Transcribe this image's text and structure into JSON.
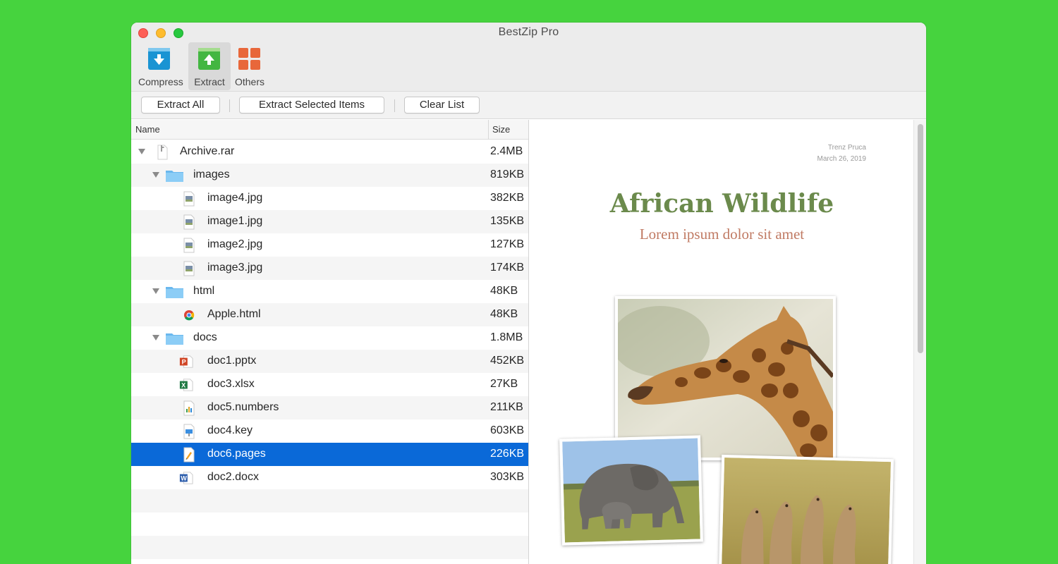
{
  "window": {
    "title": "BestZip Pro"
  },
  "toolbar": {
    "tools": [
      {
        "label": "Compress",
        "icon": "compress-icon",
        "color": "#1a94d3"
      },
      {
        "label": "Extract",
        "icon": "extract-icon",
        "color": "#43b641",
        "active": true
      },
      {
        "label": "Others",
        "icon": "grid-icon",
        "color": "#e8673a"
      }
    ]
  },
  "actions": {
    "extract_all": "Extract All",
    "extract_selected": "Extract Selected Items",
    "clear_list": "Clear List"
  },
  "filelist": {
    "columns": {
      "name": "Name",
      "size": "Size"
    },
    "rows": [
      {
        "name": "Archive.rar",
        "size": "2.4MB",
        "icon": "archive-icon",
        "expanded": true
      },
      {
        "name": "images",
        "size": "819KB",
        "icon": "folder-icon",
        "expanded": true
      },
      {
        "name": "image4.jpg",
        "size": "382KB",
        "icon": "image-file-icon"
      },
      {
        "name": "image1.jpg",
        "size": "135KB",
        "icon": "image-file-icon"
      },
      {
        "name": "image2.jpg",
        "size": "127KB",
        "icon": "image-file-icon"
      },
      {
        "name": "image3.jpg",
        "size": "174KB",
        "icon": "image-file-icon"
      },
      {
        "name": "html",
        "size": "48KB",
        "icon": "folder-icon",
        "expanded": true
      },
      {
        "name": "Apple.html",
        "size": "48KB",
        "icon": "chrome-html-icon"
      },
      {
        "name": "docs",
        "size": "1.8MB",
        "icon": "folder-icon",
        "expanded": true
      },
      {
        "name": "doc1.pptx",
        "size": "452KB",
        "icon": "powerpoint-icon"
      },
      {
        "name": "doc3.xlsx",
        "size": "27KB",
        "icon": "excel-icon"
      },
      {
        "name": "doc5.numbers",
        "size": "211KB",
        "icon": "numbers-icon"
      },
      {
        "name": "doc4.key",
        "size": "603KB",
        "icon": "keynote-icon"
      },
      {
        "name": "doc6.pages",
        "size": "226KB",
        "icon": "pages-icon",
        "selected": true
      },
      {
        "name": "doc2.docx",
        "size": "303KB",
        "icon": "word-icon"
      }
    ]
  },
  "preview": {
    "author": "Trenz Pruca",
    "date": "March 26, 2019",
    "title": "African Wildlife",
    "subtitle": "Lorem ipsum dolor sit amet",
    "photos": [
      "giraffe-photo",
      "elephant-photo",
      "meerkat-photo"
    ]
  },
  "colors": {
    "selection": "#0a69d8",
    "title_green": "#6b8a4c",
    "subtitle_rust": "#c07a63",
    "background": "#46d33e"
  }
}
